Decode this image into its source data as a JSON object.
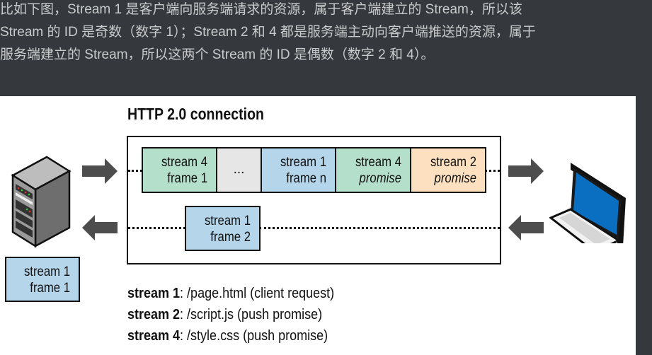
{
  "paragraph": {
    "lines": [
      "比如下图，Stream 1 是客户端向服务端请求的资源，属于客户端建立的 Stream，所以该",
      "Stream 的 ID 是奇数（数字 1）；Stream 2 和 4 都是服务端主动向客户端推送的资源，属于",
      "服务端建立的 Stream，所以这两个 Stream 的 ID 是偶数（数字 2 和 4）。"
    ]
  },
  "diagram": {
    "title": "HTTP 2.0 connection",
    "outgoing_frames": [
      {
        "line1": "stream 4",
        "line2": "frame 1"
      },
      {
        "line1": "...",
        "line2": ""
      },
      {
        "line1": "stream 1",
        "line2": "frame n"
      },
      {
        "line1": "stream 4",
        "line2": "promise"
      },
      {
        "line1": "stream 2",
        "line2": "promise"
      }
    ],
    "incoming_frame": {
      "line1": "stream 1",
      "line2": "frame 2"
    },
    "server_frame": {
      "line1": "stream 1",
      "line2": "frame 1"
    },
    "legend": [
      {
        "key": "stream 1",
        "value": ": /page.html  (client request)"
      },
      {
        "key": "stream 2",
        "value": ": /script.js  (push promise)"
      },
      {
        "key": "stream 4",
        "value": ": /style.css  (push promise)"
      }
    ],
    "colors": {
      "green": "#b4dfca",
      "gray": "#e6e6e6",
      "blue": "#b4d5ea",
      "orange": "#fde0c0",
      "arrow": "#4d4d4d"
    }
  }
}
